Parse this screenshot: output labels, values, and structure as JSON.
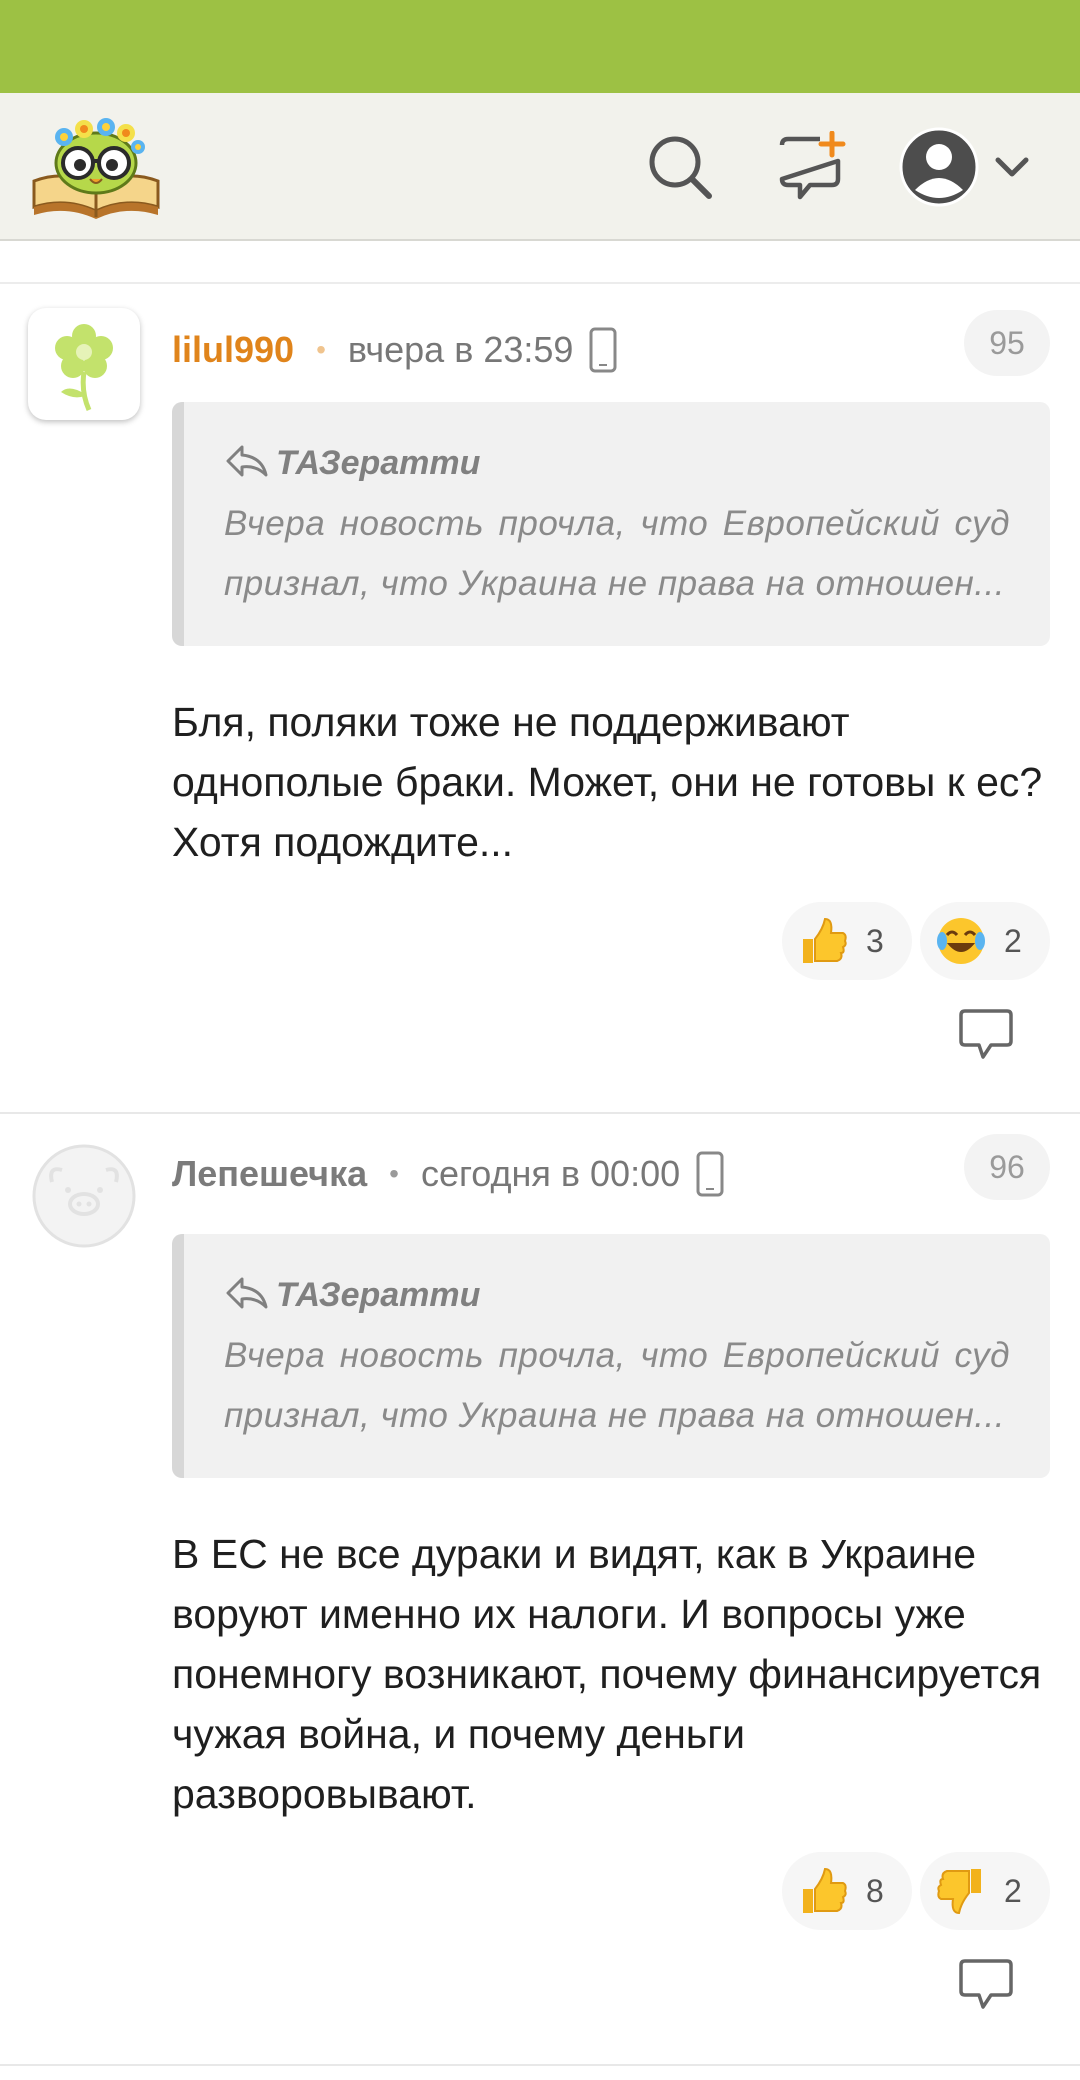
{
  "header": {
    "logo": "owl-book-logo",
    "icons": [
      "search-icon",
      "new-post-icon",
      "avatar-icon",
      "chevron-down-icon"
    ]
  },
  "comments": [
    {
      "author": "lilul990",
      "time": "вчера в 23:59",
      "number": "95",
      "quote_author": "ТАЗератти",
      "quote_text": "Вчера новость прочла, что Европейский суд признал, что Украина не права на отношен...",
      "body": "Бля, поляки тоже не поддерживают однополые браки. Может, они не готовы к ес? Хотя подождите...",
      "reactions": [
        {
          "emoji": "thumbs-up",
          "count": "3"
        },
        {
          "emoji": "laughing-tears",
          "count": "2"
        }
      ]
    },
    {
      "author": "Лепешечка",
      "time": "сегодня в 00:00",
      "number": "96",
      "quote_author": "ТАЗератти",
      "quote_text": "Вчера новость прочла, что Европейский суд признал, что Украина не права на отношен...",
      "body": "В ЕС не все дураки и видят, как в Украине воруют именно их налоги. И вопросы уже понемногу возникают, почему финансируется чужая война, и почему деньги разворовывают.",
      "reactions": [
        {
          "emoji": "thumbs-up",
          "count": "8"
        },
        {
          "emoji": "thumbs-down",
          "count": "2"
        }
      ]
    }
  ],
  "colors": {
    "status_bar": "#9dc144",
    "header_bg": "#f2f2ec",
    "author_orange": "#e0841b",
    "accent_plus": "#f08a1c"
  }
}
